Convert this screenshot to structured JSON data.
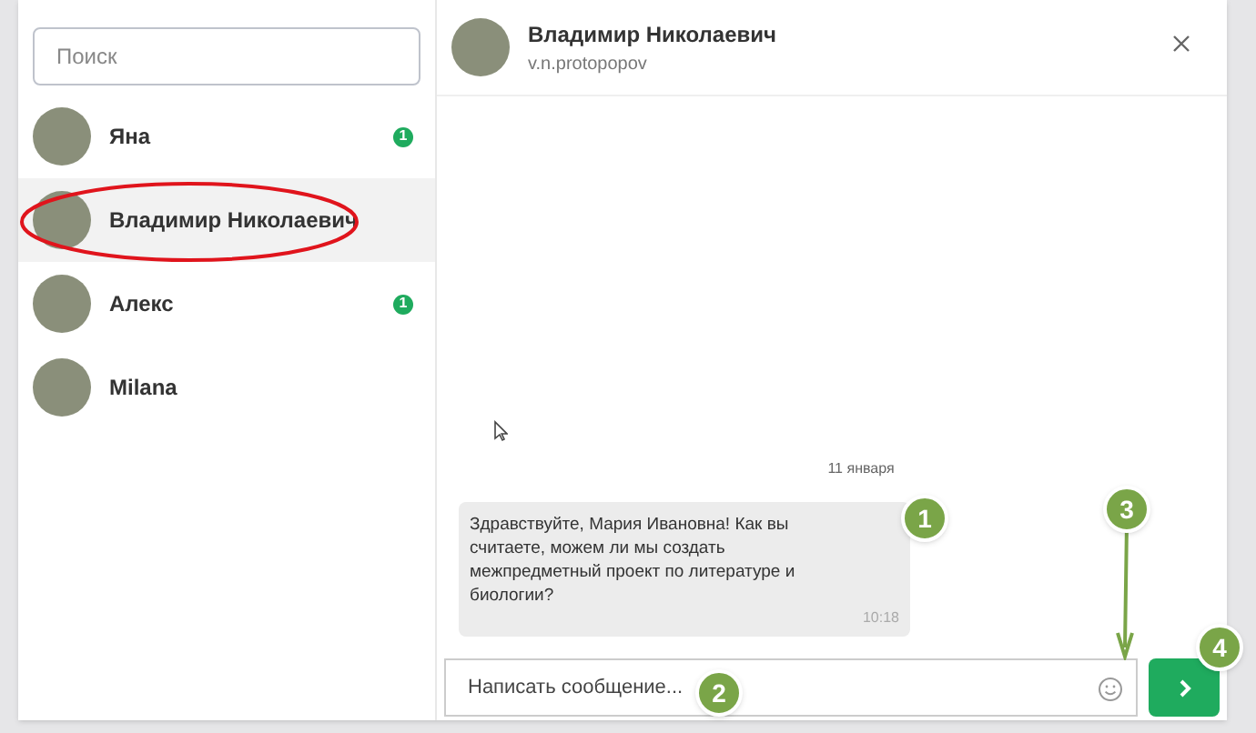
{
  "search": {
    "placeholder": "Поиск"
  },
  "contacts": [
    {
      "name": "Яна",
      "unread": "1",
      "selected": false
    },
    {
      "name": "Владимир Николаевич",
      "selected": true
    },
    {
      "name": "Алекс",
      "unread": "1",
      "selected": false
    },
    {
      "name": "Milana",
      "selected": false
    }
  ],
  "chat": {
    "name": "Владимир Николаевич",
    "username": "v.n.protopopov",
    "date": "11 января",
    "messages": [
      {
        "text": "Здравствуйте, Мария Ивановна! Как вы считаете, можем ли мы создать межпредметный проект по литературе и биологии?",
        "time": "10:18"
      }
    ],
    "input": {
      "placeholder": "Написать сообщение..."
    }
  },
  "annotations": [
    {
      "label": "1"
    },
    {
      "label": "2"
    },
    {
      "label": "3"
    },
    {
      "label": "4"
    }
  ]
}
